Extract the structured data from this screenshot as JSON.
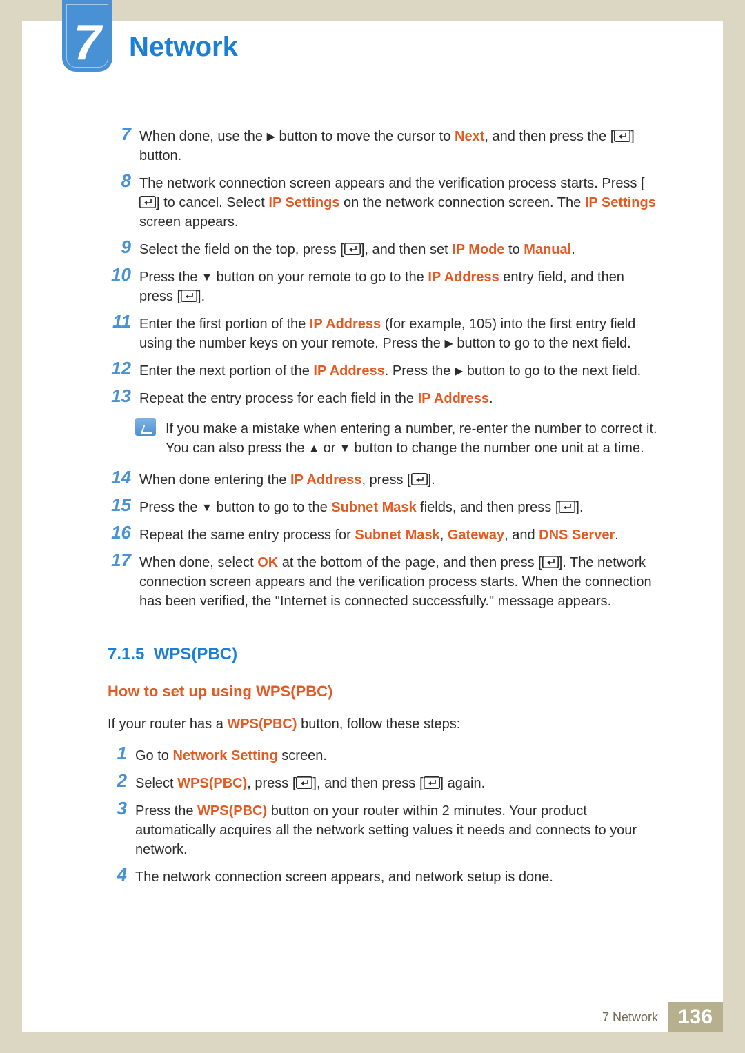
{
  "chapter": {
    "number": "7",
    "title": "Network"
  },
  "steps1": [
    {
      "n": "7",
      "parts": [
        "When done, use the ",
        {
          "tri": "▶"
        },
        " button to move the cursor to ",
        {
          "hl": "Next"
        },
        ", and then press the [",
        {
          "enter": true
        },
        "] button."
      ]
    },
    {
      "n": "8",
      "parts": [
        "The network connection screen appears and the verification process starts. Press [",
        {
          "enter": true
        },
        "] to cancel. Select ",
        {
          "hl": "IP Settings"
        },
        " on the network connection screen. The ",
        {
          "hl": "IP Settings"
        },
        " screen appears."
      ]
    },
    {
      "n": "9",
      "parts": [
        "Select the field on the top, press [",
        {
          "enter": true
        },
        "], and then set ",
        {
          "hl": "IP Mode"
        },
        " to ",
        {
          "hl": "Manual"
        },
        "."
      ]
    },
    {
      "n": "10",
      "parts": [
        "Press the ",
        {
          "tri": "▼"
        },
        " button on your remote to go to the ",
        {
          "hl": "IP Address"
        },
        " entry field, and then press [",
        {
          "enter": true
        },
        "]."
      ]
    },
    {
      "n": "11",
      "parts": [
        "Enter the first portion of the ",
        {
          "hl": "IP Address"
        },
        " (for example, 105) into the first entry field using the number keys on your remote. Press the ",
        {
          "tri": "▶"
        },
        " button to go to the next field."
      ]
    },
    {
      "n": "12",
      "parts": [
        "Enter the next portion of the ",
        {
          "hl": "IP Address"
        },
        ". Press the ",
        {
          "tri": "▶"
        },
        " button to go to the next field."
      ]
    },
    {
      "n": "13",
      "parts": [
        "Repeat the entry process for each field in the ",
        {
          "hl": "IP Address"
        },
        "."
      ]
    }
  ],
  "note": [
    "If you make a mistake when entering a number, re-enter the number to correct it. You can also press the ",
    {
      "tri": "▲"
    },
    " or ",
    {
      "tri": "▼"
    },
    " button to change the number one unit at a time."
  ],
  "steps2": [
    {
      "n": "14",
      "parts": [
        "When done entering the ",
        {
          "hl": "IP Address"
        },
        ", press [",
        {
          "enter": true
        },
        "]."
      ]
    },
    {
      "n": "15",
      "parts": [
        "Press the ",
        {
          "tri": "▼"
        },
        " button to go to the ",
        {
          "hl": "Subnet Mask"
        },
        " fields, and then press [",
        {
          "enter": true
        },
        "]."
      ]
    },
    {
      "n": "16",
      "parts": [
        "Repeat the same entry process for ",
        {
          "hl": "Subnet Mask"
        },
        ", ",
        {
          "hl": "Gateway"
        },
        ", and ",
        {
          "hl": "DNS Server"
        },
        "."
      ]
    },
    {
      "n": "17",
      "parts": [
        "When done, select ",
        {
          "hl": "OK"
        },
        " at the bottom of the page, and then press [",
        {
          "enter": true
        },
        "]. The network connection screen appears and the verification process starts. When the connection has been verified, the \"Internet is connected successfully.\" message appears."
      ]
    }
  ],
  "section": {
    "num": "7.1.5",
    "title": "WPS(PBC)",
    "sub": "How to set up using WPS(PBC)"
  },
  "wps_intro": [
    "If your router has a ",
    {
      "hl": "WPS(PBC)"
    },
    " button, follow these steps:"
  ],
  "wps_steps": [
    {
      "n": "1",
      "parts": [
        "Go to ",
        {
          "hl": "Network Setting"
        },
        " screen."
      ]
    },
    {
      "n": "2",
      "parts": [
        "Select ",
        {
          "hl": "WPS(PBC)"
        },
        ", press [",
        {
          "enter": true
        },
        "], and then press [",
        {
          "enter": true
        },
        "] again."
      ]
    },
    {
      "n": "3",
      "parts": [
        "Press the ",
        {
          "hl": "WPS(PBC)"
        },
        " button on your router within 2 minutes. Your product automatically acquires all the network setting values it needs and connects to your network."
      ]
    },
    {
      "n": "4",
      "parts": [
        "The network connection screen appears, and network setup is done."
      ]
    }
  ],
  "footer": {
    "crumb_num": "7",
    "crumb_title": "Network",
    "page": "136"
  }
}
